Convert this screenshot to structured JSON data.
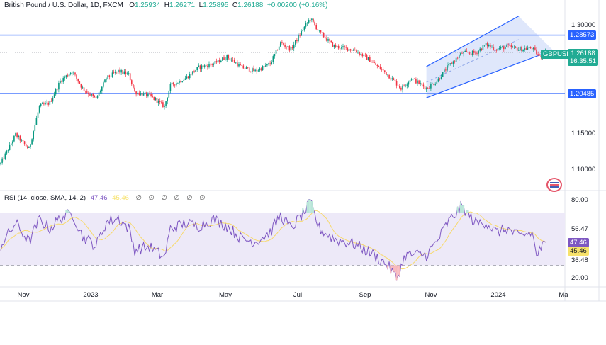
{
  "header": {
    "symbol": "British Pound / U.S. Dollar, 1D, FXCM",
    "o_label": "O",
    "o": "1.25934",
    "h_label": "H",
    "h": "1.26271",
    "l_label": "L",
    "l": "1.25895",
    "c_label": "C",
    "c": "1.26188",
    "change": "+0.00200 (+0.16%)"
  },
  "price_axis": {
    "ticks": [
      "1.30000",
      "1.15000",
      "1.10000"
    ],
    "line_high": "1.28573",
    "line_low": "1.20485",
    "last_price": "1.26188",
    "countdown": "16:35:51",
    "symbol_tag": "GBPUSD"
  },
  "rsi": {
    "label": "RSI (14, close, SMA, 14, 2)",
    "value": "47.46",
    "sma": "45.46",
    "empty_values": [
      "∅",
      "∅",
      "∅",
      "∅",
      "∅",
      "∅"
    ],
    "ticks": [
      "80.00",
      "56.47",
      "36.48",
      "20.00"
    ],
    "value_tag": "47.46",
    "sma_tag": "45.46"
  },
  "time_axis": [
    "Nov",
    "2023",
    "Mar",
    "May",
    "Jul",
    "Sep",
    "Nov",
    "2024",
    "Ma"
  ],
  "colors": {
    "up": "#089981",
    "down": "#f23645",
    "hline": "#2962ff",
    "rsi": "#7e57c2",
    "rsi_sma": "#f7d96b",
    "channel_fill": "#c9d7f8"
  },
  "chart_data": {
    "type": "candlestick",
    "title": "British Pound / U.S. Dollar, 1D, FXCM",
    "ylim": [
      1.08,
      1.335
    ],
    "price_waypoints": [
      [
        0,
        1.108
      ],
      [
        10,
        1.148
      ],
      [
        19,
        1.128
      ],
      [
        26,
        1.187
      ],
      [
        33,
        1.192
      ],
      [
        40,
        1.222
      ],
      [
        48,
        1.236
      ],
      [
        55,
        1.212
      ],
      [
        64,
        1.197
      ],
      [
        71,
        1.226
      ],
      [
        79,
        1.236
      ],
      [
        86,
        1.231
      ],
      [
        90,
        1.207
      ],
      [
        100,
        1.202
      ],
      [
        110,
        1.187
      ],
      [
        114,
        1.216
      ],
      [
        124,
        1.226
      ],
      [
        133,
        1.241
      ],
      [
        143,
        1.246
      ],
      [
        152,
        1.256
      ],
      [
        162,
        1.241
      ],
      [
        171,
        1.236
      ],
      [
        181,
        1.246
      ],
      [
        188,
        1.275
      ],
      [
        195,
        1.266
      ],
      [
        205,
        1.3
      ],
      [
        208,
        1.309
      ],
      [
        214,
        1.29
      ],
      [
        224,
        1.27
      ],
      [
        238,
        1.265
      ],
      [
        248,
        1.251
      ],
      [
        260,
        1.231
      ],
      [
        269,
        1.212
      ],
      [
        276,
        1.226
      ],
      [
        286,
        1.212
      ],
      [
        293,
        1.222
      ],
      [
        300,
        1.241
      ],
      [
        310,
        1.261
      ],
      [
        319,
        1.261
      ],
      [
        326,
        1.273
      ],
      [
        333,
        1.266
      ],
      [
        340,
        1.27
      ],
      [
        348,
        1.266
      ],
      [
        357,
        1.268
      ],
      [
        362,
        1.256
      ],
      [
        366,
        1.26188
      ]
    ],
    "rsi_waypoints": [
      [
        0,
        45
      ],
      [
        10,
        62
      ],
      [
        19,
        48
      ],
      [
        26,
        65
      ],
      [
        33,
        58
      ],
      [
        40,
        66
      ],
      [
        48,
        70
      ],
      [
        55,
        52
      ],
      [
        64,
        45
      ],
      [
        71,
        63
      ],
      [
        79,
        66
      ],
      [
        86,
        58
      ],
      [
        90,
        42
      ],
      [
        100,
        44
      ],
      [
        110,
        36
      ],
      [
        114,
        58
      ],
      [
        124,
        62
      ],
      [
        133,
        60
      ],
      [
        143,
        65
      ],
      [
        152,
        60
      ],
      [
        162,
        50
      ],
      [
        171,
        48
      ],
      [
        181,
        55
      ],
      [
        188,
        68
      ],
      [
        195,
        58
      ],
      [
        205,
        72
      ],
      [
        208,
        78
      ],
      [
        214,
        58
      ],
      [
        224,
        50
      ],
      [
        238,
        46
      ],
      [
        248,
        40
      ],
      [
        260,
        30
      ],
      [
        266,
        20
      ],
      [
        272,
        38
      ],
      [
        286,
        38
      ],
      [
        293,
        48
      ],
      [
        300,
        62
      ],
      [
        310,
        75
      ],
      [
        319,
        62
      ],
      [
        326,
        63
      ],
      [
        333,
        55
      ],
      [
        340,
        58
      ],
      [
        348,
        52
      ],
      [
        357,
        55
      ],
      [
        360,
        38
      ],
      [
        366,
        47.46
      ]
    ],
    "rsi_ylim": [
      15,
      85
    ],
    "rsi_bands": [
      30,
      70
    ],
    "hlines": [
      1.28573,
      1.20485
    ],
    "channel": {
      "upper": [
        [
          286,
          1.2422
        ],
        [
          348,
          1.312
        ]
      ],
      "lower": [
        [
          286,
          1.199
        ],
        [
          371,
          1.265
        ]
      ]
    }
  }
}
